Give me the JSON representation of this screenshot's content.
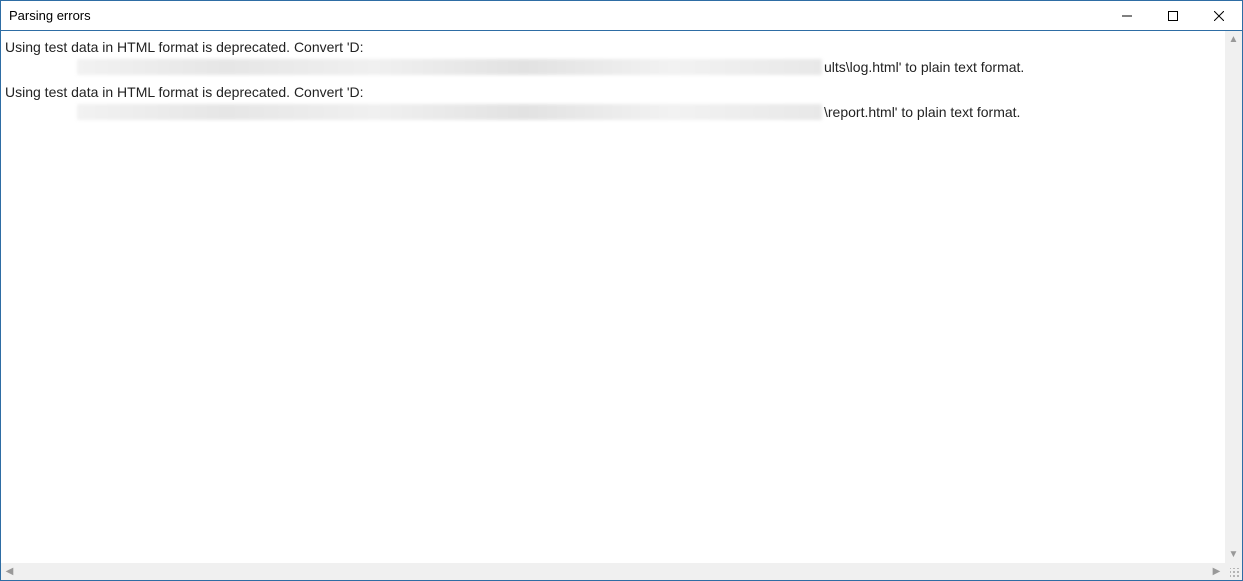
{
  "window": {
    "title": "Parsing errors"
  },
  "messages": [
    {
      "line1": "Using test data in HTML format is deprecated. Convert 'D:",
      "tail": "ults\\log.html' to plain text format."
    },
    {
      "line1": "Using test data in HTML format is deprecated. Convert 'D:",
      "tail": "\\report.html' to plain text format."
    }
  ]
}
